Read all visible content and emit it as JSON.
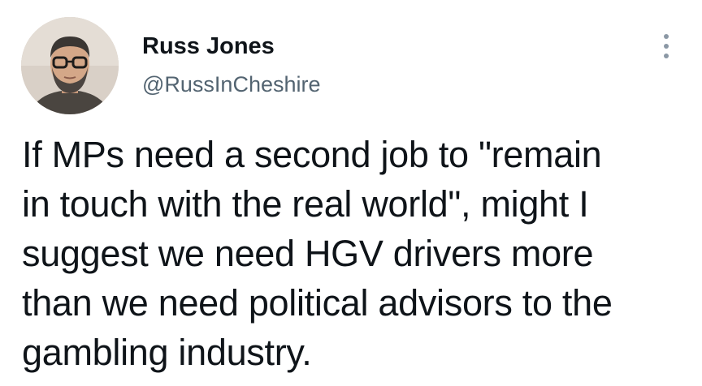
{
  "author": {
    "display_name": "Russ Jones",
    "handle": "@RussInCheshire"
  },
  "menu": {
    "icon": "more-dots-vertical-icon"
  },
  "tweet": {
    "lines": [
      "If MPs need a second job to \"remain",
      "in touch with the real world\", might I",
      "suggest we need HGV drivers more",
      "than we need political advisors to the",
      "gambling industry."
    ]
  },
  "colors": {
    "text": "#0f1419",
    "secondary_text": "#536471",
    "icon": "#8b98a5",
    "background": "#ffffff"
  }
}
